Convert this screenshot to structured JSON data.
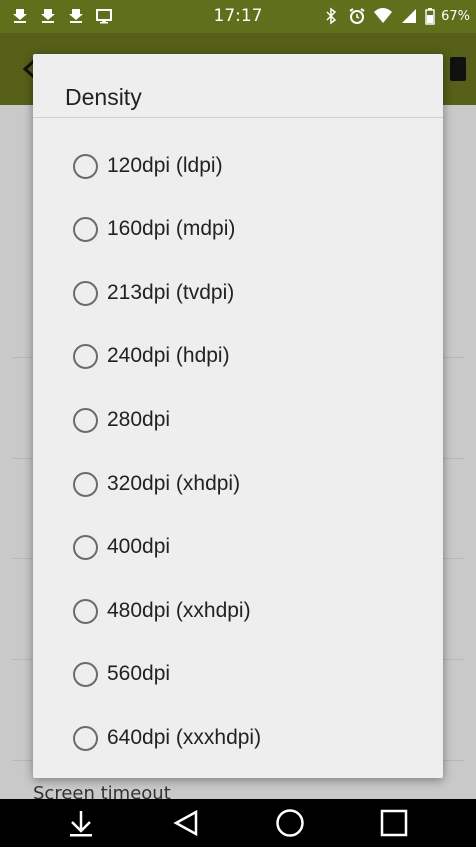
{
  "status_bar": {
    "time": "17:17",
    "battery": "67%",
    "left_icons": [
      "android-download-icon",
      "android-download-icon",
      "android-download-icon",
      "monitor-icon"
    ],
    "right_icons": [
      "bluetooth-icon",
      "alarm-icon",
      "wifi-icon",
      "signal-icon",
      "battery-icon"
    ]
  },
  "dialog": {
    "title": "Density",
    "options": [
      {
        "label": "120dpi (ldpi)"
      },
      {
        "label": "160dpi (mdpi)"
      },
      {
        "label": "213dpi (tvdpi)"
      },
      {
        "label": "240dpi (hdpi)"
      },
      {
        "label": "280dpi"
      },
      {
        "label": "320dpi (xhdpi)"
      },
      {
        "label": "400dpi"
      },
      {
        "label": "480dpi (xxhdpi)"
      },
      {
        "label": "560dpi"
      },
      {
        "label": "640dpi (xxxhdpi)"
      }
    ]
  },
  "background": {
    "hint_text": "Screen timeout"
  },
  "colors": {
    "status_bar": "#5f6f1c",
    "app_bar": "#566019",
    "dialog_bg": "#eeeeee",
    "scrim_bg": "#c9c9c9"
  }
}
